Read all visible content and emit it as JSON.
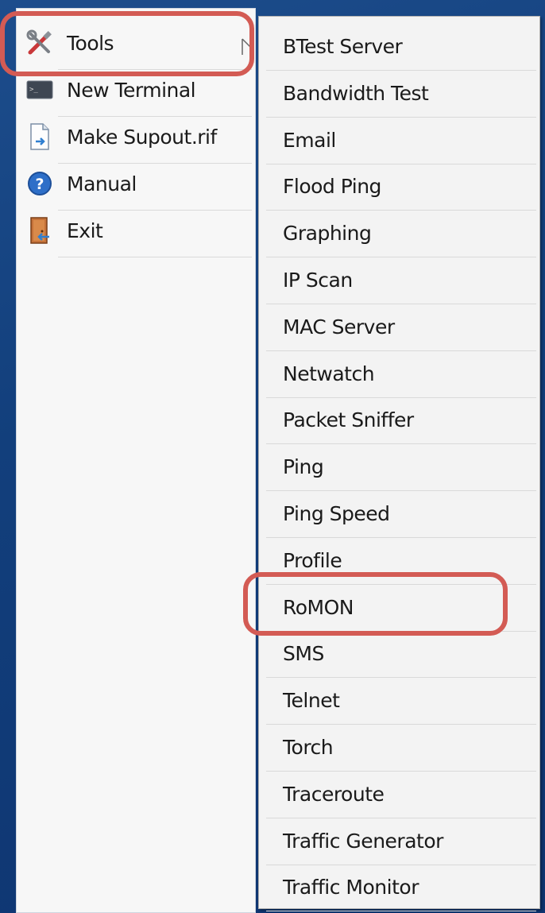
{
  "main_menu": {
    "items": [
      {
        "label": "Tools",
        "icon": "tools-icon",
        "has_submenu": true
      },
      {
        "label": "New Terminal",
        "icon": "terminal-icon"
      },
      {
        "label": "Make Supout.rif",
        "icon": "document-icon"
      },
      {
        "label": "Manual",
        "icon": "help-icon"
      },
      {
        "label": "Exit",
        "icon": "exit-door-icon"
      }
    ]
  },
  "tools_submenu": {
    "items": [
      "BTest Server",
      "Bandwidth Test",
      "Email",
      "Flood Ping",
      "Graphing",
      "IP Scan",
      "MAC Server",
      "Netwatch",
      "Packet Sniffer",
      "Ping",
      "Ping Speed",
      "Profile",
      "RoMON",
      "SMS",
      "Telnet",
      "Torch",
      "Traceroute",
      "Traffic Generator",
      "Traffic Monitor"
    ]
  },
  "highlighted": [
    "Tools",
    "RoMON"
  ],
  "colors": {
    "highlight": "#d35b54",
    "desktop": "#143f7c",
    "menu_bg": "#f7f7f7"
  }
}
